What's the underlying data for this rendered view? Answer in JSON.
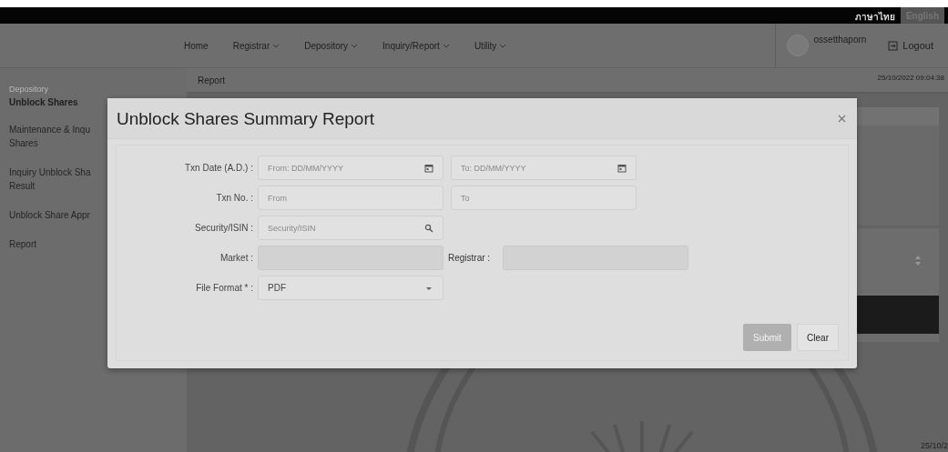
{
  "top_bar": {
    "languages": [
      {
        "label": "ภาษาไทย",
        "selected": true
      },
      {
        "label": "English",
        "selected": false
      }
    ]
  },
  "nav": {
    "items": [
      {
        "label": "Home",
        "dropdown": false
      },
      {
        "label": "Registrar",
        "dropdown": true
      },
      {
        "label": "Depository",
        "dropdown": true
      },
      {
        "label": "Inquiry/Report",
        "dropdown": true
      },
      {
        "label": "Utility",
        "dropdown": true
      }
    ],
    "user": "ossetthaporn",
    "logout": "Logout"
  },
  "sidebar": {
    "section": "Depository",
    "group": "Unblock Shares",
    "items": [
      {
        "lines": [
          "Maintenance & Inqu",
          "Shares"
        ]
      },
      {
        "lines": [
          "Inquiry Unblock Sha",
          "Result"
        ]
      },
      {
        "lines": [
          "Unblock Share Appr"
        ]
      },
      {
        "lines": [
          "Report"
        ]
      }
    ]
  },
  "breadcrumb": {
    "title": "Report",
    "datetime": "25/10/2022 09:04:38"
  },
  "modal": {
    "title": "Unblock Shares Summary Report",
    "rows": [
      {
        "label": "Txn Date (A.D.) :",
        "fields": [
          {
            "kind": "date",
            "placeholder": "From: DD/MM/YYYY",
            "disabled": false
          },
          {
            "kind": "date",
            "placeholder": "To: DD/MM/YYYY",
            "disabled": false
          }
        ]
      },
      {
        "label": "Txn No. :",
        "fields": [
          {
            "kind": "text",
            "placeholder": "From",
            "disabled": false
          },
          {
            "kind": "text",
            "placeholder": "To",
            "disabled": false
          }
        ]
      },
      {
        "label": "Security/ISIN :",
        "fields": [
          {
            "kind": "search",
            "placeholder": "Security/ISIN",
            "disabled": false
          }
        ]
      },
      {
        "label": "Market :",
        "fields": [
          {
            "kind": "text",
            "disabled": true
          },
          {
            "kind": "text",
            "label": "Registrar :",
            "disabled": true
          }
        ]
      },
      {
        "label": "File Format * :",
        "fields": [
          {
            "kind": "select",
            "value": "PDF",
            "disabled": false
          }
        ]
      }
    ],
    "buttons": [
      {
        "label": "Submit",
        "disabled": true
      },
      {
        "label": "Clear",
        "disabled": false
      }
    ]
  },
  "footer": {
    "datetime": "25/10/2"
  }
}
